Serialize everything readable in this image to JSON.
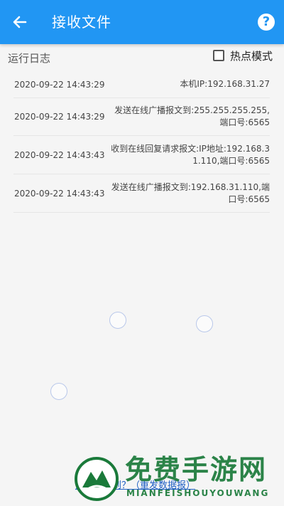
{
  "app_bar": {
    "title": "接收文件",
    "back_icon": "arrow-left-icon",
    "help_icon": "question-circle-icon",
    "help_glyph": "?",
    "color": "#2196f3"
  },
  "log_section": {
    "title": "运行日志",
    "hotspot_mode": {
      "label": "热点模式",
      "checked": false
    }
  },
  "logs": [
    {
      "time": "2020-09-22 14:43:29",
      "message": "本机IP:192.168.31.27"
    },
    {
      "time": "2020-09-22 14:43:29",
      "message": "发送在线广播报文到:255.255.255.255,端口号:6565"
    },
    {
      "time": "2020-09-22 14:43:43",
      "message": "收到在线回复请求报文:IP地址:192.168.31.110,端口号:6565"
    },
    {
      "time": "2020-09-22 14:43:43",
      "message": "发送在线广播报文到:192.168.31.110,端口号:6565"
    }
  ],
  "footer": {
    "link_text": "对方没收到？（重发数据报）"
  },
  "watermark": {
    "cn": "免费手游网",
    "en": "MIANFEISHOUYOUWANG"
  }
}
